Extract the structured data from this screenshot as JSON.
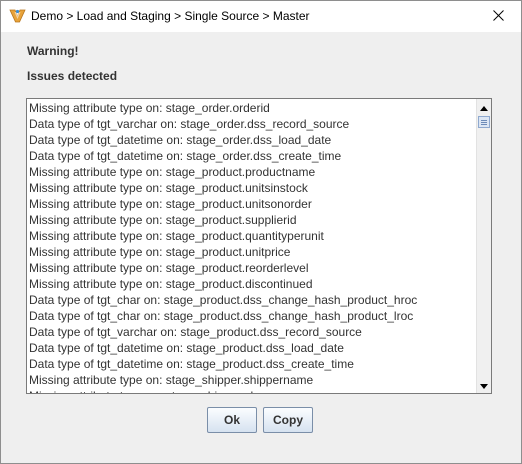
{
  "window": {
    "title": "Demo > Load and Staging > Single Source > Master",
    "app_icon": "wherescape-logo-icon",
    "close_icon": "close-icon"
  },
  "dialog": {
    "warning_label": "Warning!",
    "issues_label": "Issues detected",
    "issues": [
      "Missing attribute type on: stage_order.orderid",
      "Data type of tgt_varchar on: stage_order.dss_record_source",
      "Data type of tgt_datetime on: stage_order.dss_load_date",
      "Data type of tgt_datetime on: stage_order.dss_create_time",
      "Missing attribute type on: stage_product.productname",
      "Missing attribute type on: stage_product.unitsinstock",
      "Missing attribute type on: stage_product.unitsonorder",
      "Missing attribute type on: stage_product.supplierid",
      "Missing attribute type on: stage_product.quantityperunit",
      "Missing attribute type on: stage_product.unitprice",
      "Missing attribute type on: stage_product.reorderlevel",
      "Missing attribute type on: stage_product.discontinued",
      "Data type of tgt_char on: stage_product.dss_change_hash_product_hroc",
      "Data type of tgt_char on: stage_product.dss_change_hash_product_lroc",
      "Data type of tgt_varchar on: stage_product.dss_record_source",
      "Data type of tgt_datetime on: stage_product.dss_load_date",
      "Data type of tgt_datetime on: stage_product.dss_create_time",
      "Missing attribute type on: stage_shipper.shippername",
      "Missing attribute type on: stage_shipper.phone"
    ],
    "scroll_up_icon": "triangle-up-icon",
    "scroll_down_icon": "triangle-down-icon",
    "ok_label": "Ok",
    "copy_label": "Copy"
  }
}
